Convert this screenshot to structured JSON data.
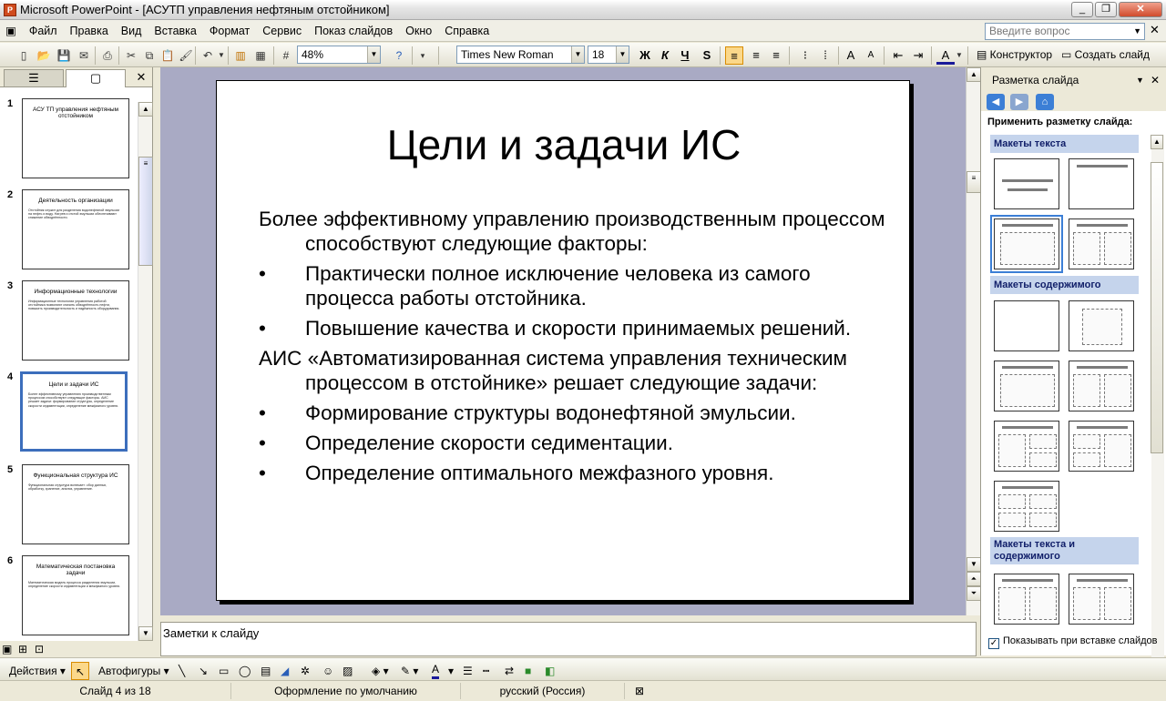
{
  "window": {
    "title": "Microsoft PowerPoint - [АСУТП управления нефтяным отстойником]",
    "app_icon_label": "P"
  },
  "menu": {
    "items": [
      "Файл",
      "Правка",
      "Вид",
      "Вставка",
      "Формат",
      "Сервис",
      "Показ слайдов",
      "Окно",
      "Справка"
    ],
    "help_placeholder": "Введите вопрос"
  },
  "toolbar": {
    "zoom": "48%",
    "font": "Times New Roman",
    "size": "18",
    "bold": "Ж",
    "italic": "К",
    "underline": "Ч",
    "shadow": "S",
    "designer_label": "Конструктор",
    "new_slide_label": "Создать слайд"
  },
  "slides": [
    {
      "num": "1",
      "title": "АСУ ТП управления нефтяным отстойником",
      "body": ""
    },
    {
      "num": "2",
      "title": "Деятельность организации",
      "body": "Отстойник служит для разделения водонефтяной эмульсии на нефть и воду. Нагрев и отстой эмульсии обеспечивают снижение обводнённости."
    },
    {
      "num": "3",
      "title": "Информационные технологии",
      "body": "Информационные технологии управления работой отстойника позволяют снизить обводнённость нефти, повысить производительность и надёжность оборудования."
    },
    {
      "num": "4",
      "title": "Цели и задачи ИС",
      "body": "Более эффективному управлению производственным процессом способствуют следующие факторы. АИС решает задачи: формирование структуры, определение скорости седиментации, определение межфазного уровня."
    },
    {
      "num": "5",
      "title": "Функциональная структура ИС",
      "body": "Функциональная структура включает: сбор данных, обработку, хранение, анализ, управление."
    },
    {
      "num": "6",
      "title": "Математическая постановка задачи",
      "body": "Математическая модель процесса разделения эмульсии, определение скорости седиментации и межфазного уровня."
    }
  ],
  "current_slide": {
    "title": "Цели и задачи ИС",
    "body": [
      {
        "type": "para",
        "text": "Более эффективному управлению производственным процессом способствуют следующие факторы:"
      },
      {
        "type": "bullet",
        "text": "Практически полное исключение человека из самого процесса работы отстойника."
      },
      {
        "type": "bullet",
        "text": "Повышение качества и скорости принимаемых решений."
      },
      {
        "type": "para",
        "text": "АИС «Автоматизированная система управления техническим процессом в отстойнике» решает следующие задачи:"
      },
      {
        "type": "bullet",
        "text": "Формирование структуры водонефтяной эмульсии."
      },
      {
        "type": "bullet",
        "text": "Определение скорости седиментации."
      },
      {
        "type": "bullet",
        "text": "Определение оптимального межфазного уровня."
      }
    ],
    "bullet_char": "•"
  },
  "notes": {
    "placeholder": "Заметки к слайду"
  },
  "taskpane": {
    "title": "Разметка слайда",
    "apply_label": "Применить разметку слайда:",
    "sections": [
      "Макеты текста",
      "Макеты содержимого",
      "Макеты текста и содержимого"
    ],
    "show_on_insert": "Показывать при вставке слайдов"
  },
  "drawing": {
    "actions": "Действия",
    "autoshapes": "Автофигуры"
  },
  "status": {
    "slide": "Слайд 4 из 18",
    "design": "Оформление по умолчанию",
    "language": "русский (Россия)"
  }
}
